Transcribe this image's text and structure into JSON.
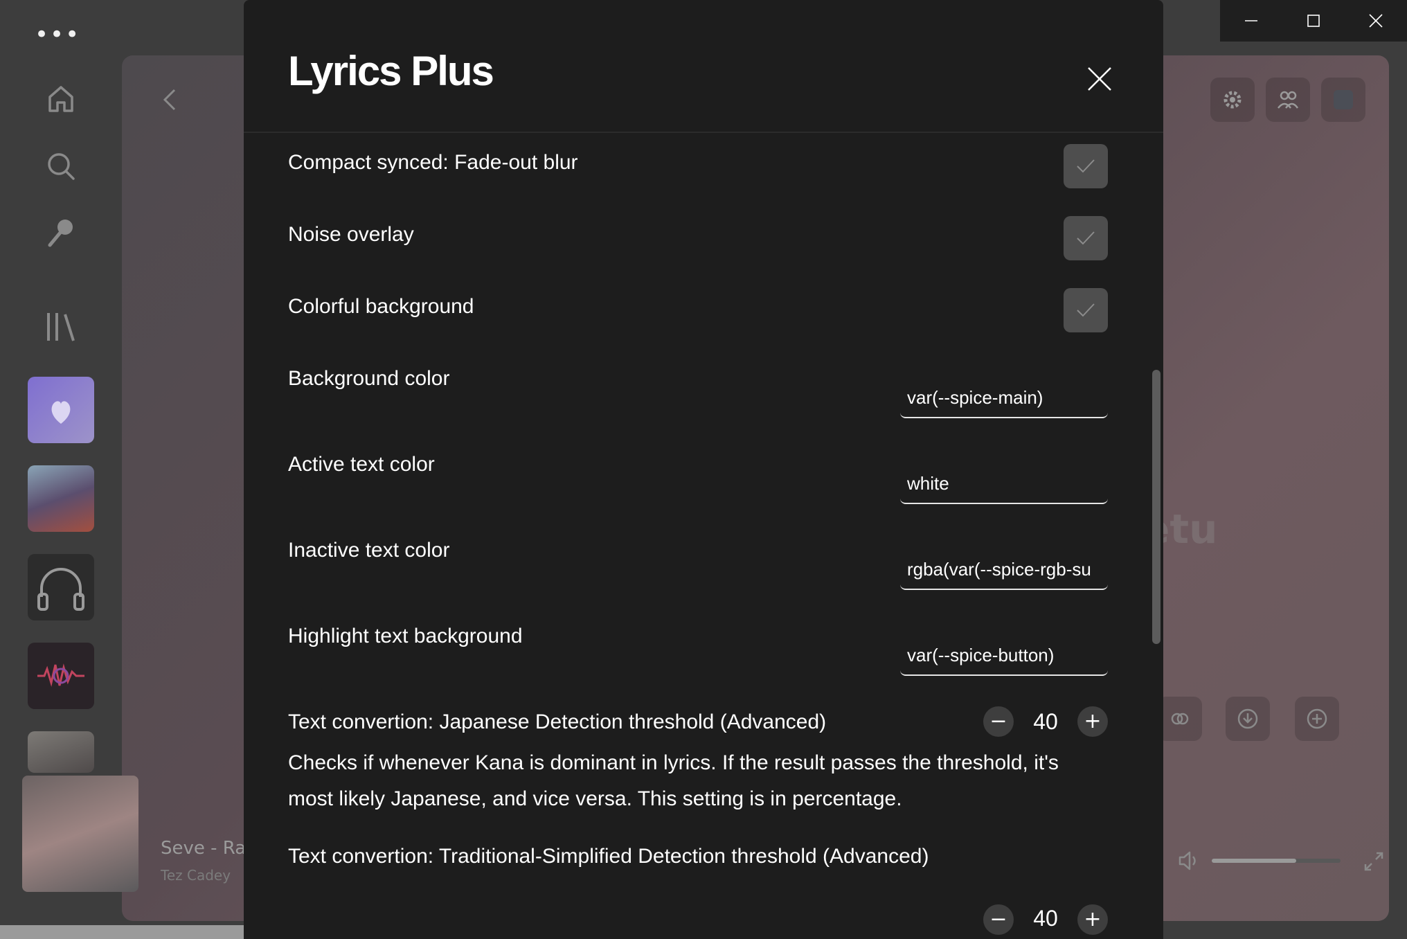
{
  "window": {
    "menu_dots": "•••",
    "controls": {
      "minimize": "minimize",
      "maximize": "maximize",
      "close": "close"
    }
  },
  "sidebar": {
    "icons": [
      "home-icon",
      "search-icon",
      "microphone-icon",
      "library-icon"
    ],
    "accent": "#7b6bd6"
  },
  "player": {
    "title": "Seve - Ra",
    "artist": "Tez Cadey",
    "background_word": "etu",
    "volume_fraction": 0.66
  },
  "dialog": {
    "title": "Lyrics Plus",
    "close_label": "close",
    "toggles": [
      {
        "label": "Compact synced: Fade-out blur",
        "checked": true
      },
      {
        "label": "Noise overlay",
        "checked": true
      },
      {
        "label": "Colorful background",
        "checked": true
      }
    ],
    "text_settings": [
      {
        "label": "Background color",
        "value": "var(--spice-main)"
      },
      {
        "label": "Active text color",
        "value": "white"
      },
      {
        "label": "Inactive text color",
        "value": "rgba(var(--spice-rgb-su"
      },
      {
        "label": "Highlight text background",
        "value": "var(--spice-button)"
      }
    ],
    "thresholds": [
      {
        "label": "Text convertion: Japanese Detection threshold (Advanced)",
        "value": "40",
        "description": "Checks if whenever Kana is dominant in lyrics. If the result passes the threshold, it's most likely Japanese, and vice versa. This setting is in percentage."
      },
      {
        "label": "Text convertion: Traditional-Simplified Detection threshold (Advanced)",
        "value": "40"
      }
    ],
    "stepper": {
      "minus": "−",
      "plus": "+"
    }
  },
  "colors": {
    "dialog_bg": "#1d1d1d",
    "checkbox_bg": "#4e4e4e",
    "text": "#ffffff"
  }
}
